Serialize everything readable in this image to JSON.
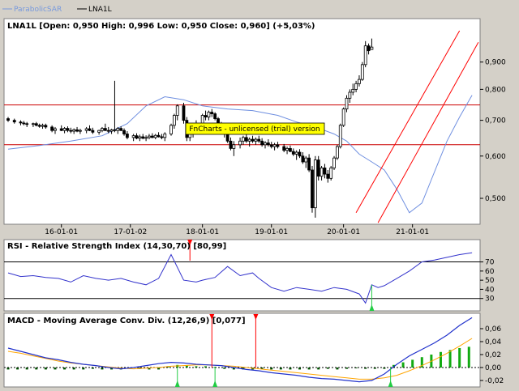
{
  "legend": [
    {
      "label": "ParabolicSAR",
      "color": "#7799dd"
    },
    {
      "label": "LNA1L",
      "color": "#000000"
    }
  ],
  "watermark": "FnCharts - unlicensed (trial) version",
  "colors": {
    "background": "#ffffff",
    "frame": "#d4d0c8",
    "price_sma": "#6f8fe0",
    "channel": "#ff0000",
    "hline": "#cc0000",
    "rsi_line": "#3333cc",
    "macd_line": "#2233cc",
    "signal_line": "#ffa500",
    "hist_pos": "#11aa11",
    "hist_neg": "#005500",
    "arrow_up": "#22cc44",
    "arrow_down": "#ff0000",
    "watermark_bg": "#ffff00"
  },
  "chart_data": [
    {
      "type": "candlestick",
      "title": "LNA1L [Open: 0,950  High: 0,996  Low: 0,950  Close: 0,960] (+5,03%)",
      "x_ticks": [
        {
          "i": 17,
          "label": "16-01-01"
        },
        {
          "i": 39,
          "label": "17-01-02"
        },
        {
          "i": 62,
          "label": "18-01-01"
        },
        {
          "i": 84,
          "label": "19-01-01"
        },
        {
          "i": 107,
          "label": "20-01-01"
        },
        {
          "i": 129,
          "label": "21-01-01"
        }
      ],
      "y_scale": "log",
      "y_ticks": [
        {
          "v": 0.5,
          "label": "0,500"
        },
        {
          "v": 0.6,
          "label": "0,600"
        },
        {
          "v": 0.7,
          "label": "0,700"
        },
        {
          "v": 0.8,
          "label": "0,800"
        },
        {
          "v": 0.9,
          "label": "0,900"
        }
      ],
      "ylim": [
        0.455,
        1.03
      ],
      "x_count": 150,
      "candles": [
        [
          0.705,
          0.71,
          0.695,
          0.7
        ],
        [
          0.7,
          0.705,
          0.69,
          0.695
        ],
        [
          0.695,
          0.7,
          0.685,
          0.692
        ],
        [
          0.692,
          0.698,
          0.685,
          0.69
        ],
        [
          0.69,
          0.695,
          0.68,
          0.688
        ],
        [
          0.688,
          0.693,
          0.68,
          0.69
        ],
        [
          0.69,
          0.695,
          0.682,
          0.685
        ],
        [
          0.685,
          0.69,
          0.678,
          0.682
        ],
        [
          0.682,
          0.69,
          0.675,
          0.685
        ],
        [
          0.685,
          0.69,
          0.675,
          0.68
        ],
        [
          0.68,
          0.685,
          0.665,
          0.67
        ],
        [
          0.67,
          0.68,
          0.66,
          0.675
        ],
        [
          0.675,
          0.685,
          0.668,
          0.67
        ],
        [
          0.67,
          0.68,
          0.662,
          0.676
        ],
        [
          0.676,
          0.682,
          0.665,
          0.67
        ],
        [
          0.67,
          0.678,
          0.662,
          0.668
        ],
        [
          0.668,
          0.676,
          0.66,
          0.672
        ],
        [
          0.672,
          0.68,
          0.665,
          0.668
        ],
        [
          0.668,
          0.675,
          0.66,
          0.67
        ],
        [
          0.67,
          0.68,
          0.662,
          0.675
        ],
        [
          0.675,
          0.685,
          0.668,
          0.67
        ],
        [
          0.67,
          0.678,
          0.66,
          0.665
        ],
        [
          0.665,
          0.672,
          0.658,
          0.67
        ],
        [
          0.67,
          0.68,
          0.665,
          0.676
        ],
        [
          0.676,
          0.69,
          0.668,
          0.67
        ],
        [
          0.67,
          0.68,
          0.662,
          0.668
        ],
        [
          0.668,
          0.675,
          0.66,
          0.672
        ],
        [
          0.672,
          0.83,
          0.665,
          0.67
        ],
        [
          0.67,
          0.68,
          0.66,
          0.676
        ],
        [
          0.676,
          0.682,
          0.668,
          0.67
        ],
        [
          0.67,
          0.676,
          0.655,
          0.66
        ],
        [
          0.66,
          0.668,
          0.645,
          0.65
        ],
        [
          0.65,
          0.66,
          0.64,
          0.655
        ],
        [
          0.655,
          0.662,
          0.645,
          0.648
        ],
        [
          0.648,
          0.658,
          0.64,
          0.652
        ],
        [
          0.652,
          0.66,
          0.645,
          0.648
        ],
        [
          0.648,
          0.656,
          0.64,
          0.65
        ],
        [
          0.65,
          0.66,
          0.645,
          0.654
        ],
        [
          0.654,
          0.662,
          0.648,
          0.65
        ],
        [
          0.65,
          0.66,
          0.645,
          0.656
        ],
        [
          0.656,
          0.665,
          0.65,
          0.652
        ],
        [
          0.652,
          0.66,
          0.645,
          0.65
        ],
        [
          0.65,
          0.665,
          0.64,
          0.66
        ],
        [
          0.66,
          0.69,
          0.655,
          0.685
        ],
        [
          0.685,
          0.72,
          0.675,
          0.715
        ],
        [
          0.715,
          0.75,
          0.7,
          0.745
        ],
        [
          0.745,
          0.755,
          0.69,
          0.7
        ],
        [
          0.7,
          0.71,
          0.64,
          0.65
        ],
        [
          0.65,
          0.67,
          0.64,
          0.66
        ],
        [
          0.66,
          0.69,
          0.65,
          0.68
        ],
        [
          0.68,
          0.7,
          0.665,
          0.69
        ],
        [
          0.69,
          0.72,
          0.68,
          0.715
        ],
        [
          0.715,
          0.73,
          0.7,
          0.71
        ],
        [
          0.71,
          0.73,
          0.7,
          0.725
        ],
        [
          0.725,
          0.735,
          0.71,
          0.72
        ],
        [
          0.72,
          0.725,
          0.7,
          0.705
        ],
        [
          0.705,
          0.71,
          0.68,
          0.69
        ],
        [
          0.69,
          0.695,
          0.665,
          0.67
        ],
        [
          0.67,
          0.68,
          0.65,
          0.66
        ],
        [
          0.66,
          0.665,
          0.635,
          0.64
        ],
        [
          0.64,
          0.65,
          0.615,
          0.62
        ],
        [
          0.62,
          0.64,
          0.6,
          0.63
        ],
        [
          0.63,
          0.65,
          0.62,
          0.64
        ],
        [
          0.64,
          0.655,
          0.63,
          0.65
        ],
        [
          0.65,
          0.66,
          0.635,
          0.64
        ],
        [
          0.64,
          0.65,
          0.625,
          0.645
        ],
        [
          0.645,
          0.655,
          0.635,
          0.64
        ],
        [
          0.64,
          0.65,
          0.63,
          0.645
        ],
        [
          0.645,
          0.655,
          0.635,
          0.64
        ],
        [
          0.64,
          0.648,
          0.625,
          0.63
        ],
        [
          0.63,
          0.64,
          0.62,
          0.635
        ],
        [
          0.635,
          0.645,
          0.625,
          0.63
        ],
        [
          0.63,
          0.638,
          0.62,
          0.625
        ],
        [
          0.625,
          0.635,
          0.615,
          0.63
        ],
        [
          0.63,
          0.638,
          0.62,
          0.625
        ],
        [
          0.625,
          0.632,
          0.61,
          0.615
        ],
        [
          0.615,
          0.625,
          0.605,
          0.62
        ],
        [
          0.62,
          0.628,
          0.61,
          0.612
        ],
        [
          0.612,
          0.62,
          0.6,
          0.605
        ],
        [
          0.605,
          0.615,
          0.59,
          0.61
        ],
        [
          0.61,
          0.618,
          0.595,
          0.6
        ],
        [
          0.6,
          0.61,
          0.58,
          0.585
        ],
        [
          0.585,
          0.6,
          0.57,
          0.595
        ],
        [
          0.595,
          0.605,
          0.56,
          0.565
        ],
        [
          0.565,
          0.575,
          0.47,
          0.48
        ],
        [
          0.48,
          0.6,
          0.46,
          0.59
        ],
        [
          0.59,
          0.6,
          0.54,
          0.55
        ],
        [
          0.55,
          0.575,
          0.54,
          0.57
        ],
        [
          0.57,
          0.58,
          0.545,
          0.555
        ],
        [
          0.555,
          0.565,
          0.535,
          0.545
        ],
        [
          0.545,
          0.575,
          0.54,
          0.57
        ],
        [
          0.57,
          0.6,
          0.565,
          0.595
        ],
        [
          0.595,
          0.63,
          0.59,
          0.625
        ],
        [
          0.625,
          0.69,
          0.62,
          0.685
        ],
        [
          0.685,
          0.74,
          0.68,
          0.735
        ],
        [
          0.735,
          0.78,
          0.725,
          0.77
        ],
        [
          0.77,
          0.8,
          0.755,
          0.79
        ],
        [
          0.79,
          0.82,
          0.78,
          0.8
        ],
        [
          0.8,
          0.83,
          0.79,
          0.82
        ],
        [
          0.82,
          0.85,
          0.81,
          0.835
        ],
        [
          0.835,
          0.9,
          0.83,
          0.89
        ],
        [
          0.89,
          0.985,
          0.88,
          0.965
        ],
        [
          0.965,
          0.975,
          0.93,
          0.945
        ],
        [
          0.95,
          0.996,
          0.95,
          0.96
        ]
      ],
      "candle_x": [
        0,
        2,
        4,
        5,
        6,
        8,
        9,
        10,
        11,
        12,
        14,
        15,
        17,
        18,
        19,
        20,
        21,
        22,
        23,
        25,
        26,
        27,
        29,
        30,
        31,
        32,
        33,
        34,
        35,
        36,
        37,
        38,
        40,
        41,
        42,
        43,
        44,
        45,
        46,
        47,
        48,
        49,
        50,
        52,
        53,
        54,
        56,
        57,
        58,
        59,
        60,
        62,
        63,
        64,
        65,
        66,
        67,
        68,
        69,
        70,
        71,
        72,
        74,
        75,
        76,
        77,
        78,
        79,
        80,
        81,
        82,
        83,
        84,
        85,
        86,
        88,
        89,
        90,
        91,
        92,
        93,
        94,
        95,
        96,
        97,
        98,
        99,
        100,
        101,
        102,
        103,
        104,
        105,
        106,
        107,
        108,
        109,
        110,
        111,
        112,
        113,
        114,
        115,
        116,
        117,
        118,
        119,
        120,
        121,
        122,
        123,
        124,
        125,
        126,
        127,
        128,
        129,
        130,
        131,
        132,
        133,
        134,
        135,
        136,
        137,
        138,
        139,
        140,
        141,
        142,
        143,
        144,
        145,
        146,
        147,
        148,
        149
      ],
      "hlines": [
        0.748,
        0.63
      ],
      "sma": {
        "x": [
          0,
          10,
          20,
          30,
          38,
          44,
          50,
          56,
          62,
          70,
          78,
          86,
          92,
          98,
          104,
          108,
          112,
          116,
          120,
          124,
          128,
          132,
          136,
          140,
          144,
          148
        ],
        "y": [
          0.618,
          0.628,
          0.64,
          0.655,
          0.69,
          0.745,
          0.775,
          0.765,
          0.745,
          0.735,
          0.73,
          0.715,
          0.695,
          0.68,
          0.66,
          0.64,
          0.605,
          0.585,
          0.565,
          0.52,
          0.47,
          0.49,
          0.56,
          0.64,
          0.71,
          0.78
        ]
      },
      "channel": [
        {
          "x0": 111,
          "y0": 0.47,
          "x1": 144,
          "y1": 1.03
        },
        {
          "x0": 118,
          "y0": 0.45,
          "x1": 150,
          "y1": 0.98
        }
      ]
    },
    {
      "type": "line",
      "title": "RSI - Relative Strength Index (14,30,70) [80,99]",
      "ylim": [
        20,
        82
      ],
      "y_ticks": [
        30,
        40,
        50,
        60,
        70
      ],
      "hlines": [
        70,
        30
      ],
      "x": [
        0,
        4,
        8,
        12,
        16,
        20,
        24,
        28,
        32,
        36,
        40,
        44,
        48,
        52,
        56,
        60,
        62,
        66,
        70,
        74,
        78,
        80,
        84,
        88,
        92,
        96,
        100,
        104,
        108,
        112,
        114,
        116,
        118,
        120,
        124,
        128,
        132,
        136,
        140,
        144,
        148
      ],
      "values": [
        58,
        54,
        55,
        53,
        52,
        48,
        55,
        52,
        50,
        52,
        48,
        45,
        52,
        78,
        50,
        48,
        50,
        53,
        65,
        55,
        58,
        52,
        42,
        38,
        42,
        40,
        38,
        42,
        40,
        35,
        25,
        45,
        42,
        44,
        52,
        60,
        70,
        72,
        75,
        78,
        80
      ],
      "down_arrows_x": [
        58
      ],
      "up_arrows_x": [
        116
      ]
    },
    {
      "type": "bar+line",
      "title": "MACD - Moving Average Conv. Div. (12,26,9) [0,077]",
      "ylim": [
        -0.025,
        0.07
      ],
      "y_ticks": [
        {
          "v": 0.06,
          "label": "0,06"
        },
        {
          "v": 0.04,
          "label": "0,04"
        },
        {
          "v": 0.02,
          "label": "0,02"
        },
        {
          "v": 0.0,
          "label": "0,00"
        },
        {
          "v": -0.02,
          "label": "-0,02"
        }
      ],
      "x": [
        0,
        4,
        8,
        12,
        16,
        20,
        24,
        28,
        32,
        36,
        40,
        44,
        48,
        52,
        56,
        60,
        64,
        68,
        72,
        76,
        80,
        84,
        88,
        92,
        96,
        100,
        104,
        108,
        112,
        116,
        120,
        124,
        128,
        132,
        136,
        140,
        144,
        148
      ],
      "macd": [
        0.03,
        0.025,
        0.02,
        0.015,
        0.012,
        0.008,
        0.005,
        0.003,
        0.0,
        -0.002,
        0.0,
        0.003,
        0.006,
        0.008,
        0.007,
        0.005,
        0.004,
        0.003,
        0.0,
        -0.003,
        -0.005,
        -0.008,
        -0.01,
        -0.012,
        -0.015,
        -0.017,
        -0.018,
        -0.02,
        -0.022,
        -0.02,
        -0.01,
        0.005,
        0.018,
        0.028,
        0.038,
        0.05,
        0.065,
        0.077
      ],
      "signal": [
        0.025,
        0.022,
        0.018,
        0.014,
        0.01,
        0.007,
        0.005,
        0.003,
        0.001,
        -0.001,
        -0.002,
        -0.001,
        0.0,
        0.002,
        0.003,
        0.004,
        0.004,
        0.003,
        0.002,
        0.0,
        -0.002,
        -0.004,
        -0.006,
        -0.008,
        -0.01,
        -0.012,
        -0.014,
        -0.016,
        -0.018,
        -0.018,
        -0.016,
        -0.012,
        -0.005,
        0.003,
        0.012,
        0.022,
        0.033,
        0.045
      ],
      "hist_x": [
        0,
        3,
        6,
        9,
        12,
        15,
        18,
        21,
        24,
        27,
        30,
        33,
        36,
        39,
        42,
        45,
        48,
        51,
        54,
        57,
        60,
        63,
        66,
        69,
        72,
        75,
        78,
        81,
        84,
        87,
        90,
        93,
        96,
        99,
        102,
        105,
        108,
        111,
        114,
        117,
        120,
        123,
        126,
        129,
        132,
        135,
        138,
        141,
        144,
        147
      ],
      "hist": [
        -0.003,
        -0.003,
        -0.003,
        -0.003,
        -0.003,
        -0.003,
        -0.003,
        -0.003,
        -0.003,
        -0.002,
        -0.003,
        -0.003,
        -0.003,
        -0.002,
        -0.002,
        -0.003,
        -0.003,
        0.002,
        0.004,
        0.003,
        0.002,
        0.002,
        0.001,
        -0.002,
        -0.003,
        -0.003,
        -0.003,
        -0.002,
        -0.003,
        -0.003,
        -0.003,
        -0.003,
        -0.003,
        -0.003,
        -0.002,
        -0.003,
        -0.002,
        -0.001,
        -0.002,
        -0.002,
        -0.002,
        0.004,
        0.008,
        0.012,
        0.016,
        0.02,
        0.024,
        0.027,
        0.03,
        0.032
      ],
      "down_arrows_x": [
        65,
        79
      ],
      "up_arrows_x": [
        54,
        66,
        122
      ]
    }
  ]
}
